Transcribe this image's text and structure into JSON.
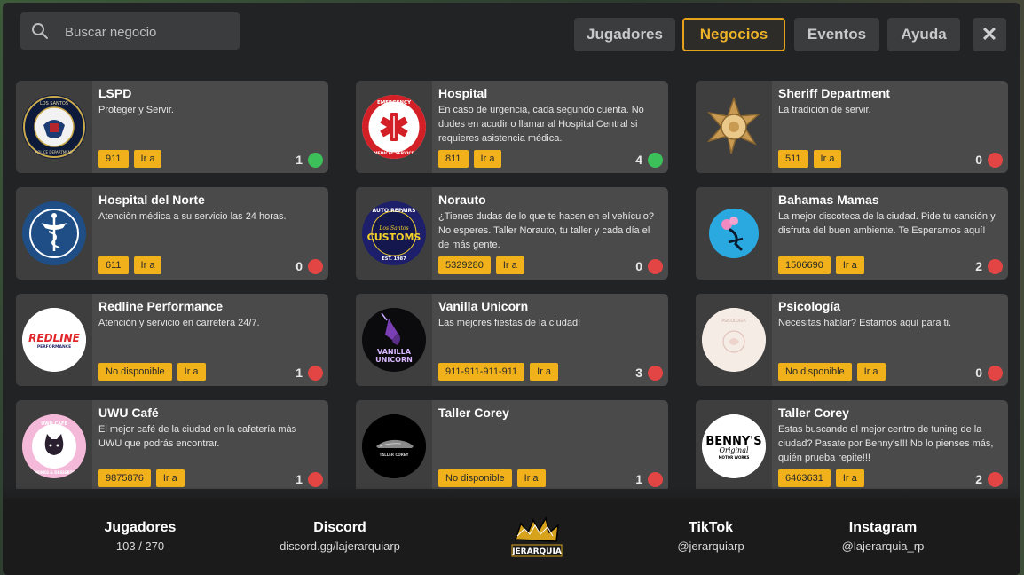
{
  "search": {
    "placeholder": "Buscar negocio"
  },
  "tabs": [
    {
      "label": "Jugadores",
      "active": false
    },
    {
      "label": "Negocios",
      "active": true
    },
    {
      "label": "Eventos",
      "active": false
    },
    {
      "label": "Ayuda",
      "active": false
    }
  ],
  "close_label": "✕",
  "business_cards": [
    {
      "name": "LSPD",
      "description": "Proteger y Servir.",
      "phone": "911",
      "go_label": "Ir a",
      "count": "1",
      "online": true,
      "logo": "lspd-seal-icon"
    },
    {
      "name": "Hospital",
      "description": "En caso de urgencia, cada segundo cuenta. No dudes en acudir o llamar al Hospital Central si requieres asistencia médica.",
      "phone": "811",
      "go_label": "Ir a",
      "count": "4",
      "online": true,
      "logo": "emergency-medical-service-icon"
    },
    {
      "name": "Sheriff Department",
      "description": "La tradición de servir.",
      "phone": "511",
      "go_label": "Ir a",
      "count": "0",
      "online": false,
      "logo": "sheriff-star-icon"
    },
    {
      "name": "Hospital del Norte",
      "description": "Atenciòn médica a su servicio las 24 horas.",
      "phone": "611",
      "go_label": "Ir a",
      "count": "0",
      "online": false,
      "logo": "caduceus-icon"
    },
    {
      "name": "Norauto",
      "description": "¿Tienes dudas de lo que te hacen en el vehículo? No esperes. Taller Norauto, tu taller y cada día el de más gente.",
      "phone": "5329280",
      "go_label": "Ir a",
      "count": "0",
      "online": false,
      "logo": "auto-repairs-customs-icon"
    },
    {
      "name": "Bahamas Mamas",
      "description": "La mejor discoteca de la ciudad. Pide tu canción y disfruta del buen ambiente. Te Esperamos aquí!",
      "phone": "1506690",
      "go_label": "Ir a",
      "count": "2",
      "online": false,
      "logo": "bahamas-mamas-icon"
    },
    {
      "name": "Redline Performance",
      "description": "Atención y servicio en carretera 24/7.",
      "phone": "No disponible",
      "go_label": "Ir a",
      "count": "1",
      "online": false,
      "logo": "redline-performance-icon"
    },
    {
      "name": "Vanilla Unicorn",
      "description": "Las mejores fiestas de la ciudad!",
      "phone": "911-911-911-911",
      "go_label": "Ir a",
      "count": "3",
      "online": false,
      "logo": "vanilla-unicorn-icon"
    },
    {
      "name": "Psicología",
      "description": "Necesitas hablar? Estamos aquí para ti.",
      "phone": "No disponible",
      "go_label": "Ir a",
      "count": "0",
      "online": false,
      "logo": "psicologia-icon"
    },
    {
      "name": "UWU Café",
      "description": "El mejor café de la ciudad en la cafetería màs UWU que podrás encontrar.",
      "phone": "9875876",
      "go_label": "Ir a",
      "count": "1",
      "online": false,
      "logo": "uwu-cafe-cat-icon"
    },
    {
      "name": "Taller Corey",
      "description": "",
      "phone": "No disponible",
      "go_label": "Ir a",
      "count": "1",
      "online": false,
      "logo": "taller-corey-car-icon"
    },
    {
      "name": "Taller Corey",
      "description": "Estas buscando el mejor centro de tuning de la ciudad? Pasate por Benny's!!! No lo pienses más, quién prueba repite!!!",
      "phone": "6463631",
      "go_label": "Ir a",
      "count": "2",
      "online": false,
      "logo": "bennys-original-motor-works-icon"
    }
  ],
  "logo_text": {
    "lspd_top": "LOS SANTOS",
    "lspd_bottom": "POLICE DEPARTMENT",
    "hospital_top": "EMERGENCY",
    "hospital_bottom": "MEDICAL SERVICE",
    "norauto_top": "AUTO REPAIRS",
    "norauto_script": "Los Santos",
    "norauto_main": "CUSTOMS",
    "norauto_est": "EST. 1987",
    "redline": "REDLINE",
    "redline_sub": "PERFORMANCE",
    "vanilla_1": "VANILLA",
    "vanilla_2": "UNICORN",
    "psicologia": "PSICOLOGIA",
    "uwu_top": "UWU CAFE",
    "uwu_bottom": "DRINKS & DESSERTS",
    "corey": "TALLER COREY",
    "bennys_1": "BENNY'S",
    "bennys_2": "Original",
    "bennys_3": "MOTOR WORKS",
    "footer_logo": "JERARQUIA"
  },
  "footer": {
    "players": {
      "title": "Jugadores",
      "value": "103 / 270"
    },
    "discord": {
      "title": "Discord",
      "value": "discord.gg/lajerarquiarp"
    },
    "tiktok": {
      "title": "TikTok",
      "value": "@jerarquiarp"
    },
    "instagram": {
      "title": "Instagram",
      "value": "@lajerarquia_rp"
    }
  },
  "colors": {
    "accent": "#f0b11b",
    "online": "#3cc15a",
    "offline": "#e34545"
  }
}
